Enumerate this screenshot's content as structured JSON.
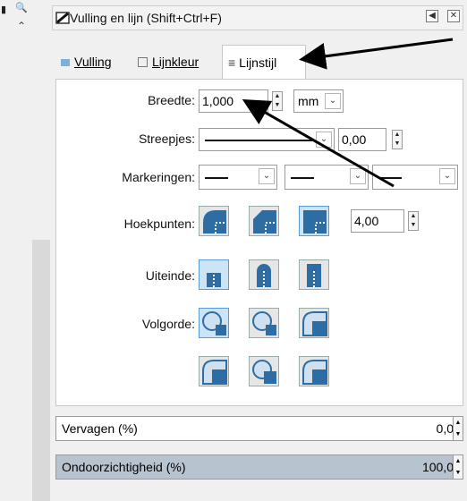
{
  "dialog": {
    "title": "Vulling en lijn (Shift+Ctrl+F)",
    "tabs": [
      {
        "label": "Vulling",
        "mnemonic": "V"
      },
      {
        "label": "Lijnkleur",
        "mnemonic": "L"
      },
      {
        "label": "Lijnstijl",
        "mnemonic": "s"
      }
    ],
    "active_tab": "Lijnstijl"
  },
  "stroke_style": {
    "width_label": "Breedte:",
    "width_value": "1,000",
    "unit_value": "mm",
    "dashes_label": "Streepjes:",
    "dash_offset": "0,00",
    "markers_label": "Markeringen:",
    "joins_label": "Hoekpunten:",
    "miter_limit": "4,00",
    "caps_label": "Uiteinde:",
    "order_label": "Volgorde:"
  },
  "blur": {
    "label": "Vervagen (%)",
    "value": "0,0"
  },
  "opacity": {
    "label": "Ondoorzichtigheid (%)",
    "value": "100,0",
    "level": 1.0
  },
  "colors": {
    "selection_blue": "#cde4f7",
    "icon_blue": "#2e6da4",
    "opacity_fill": "#b7c4cf",
    "arrow": "#000000"
  },
  "icons": [
    "fill-stroke-icon",
    "restore-icon",
    "close-icon",
    "spin-up-icon",
    "spin-down-icon",
    "chevron-down-icon"
  ]
}
